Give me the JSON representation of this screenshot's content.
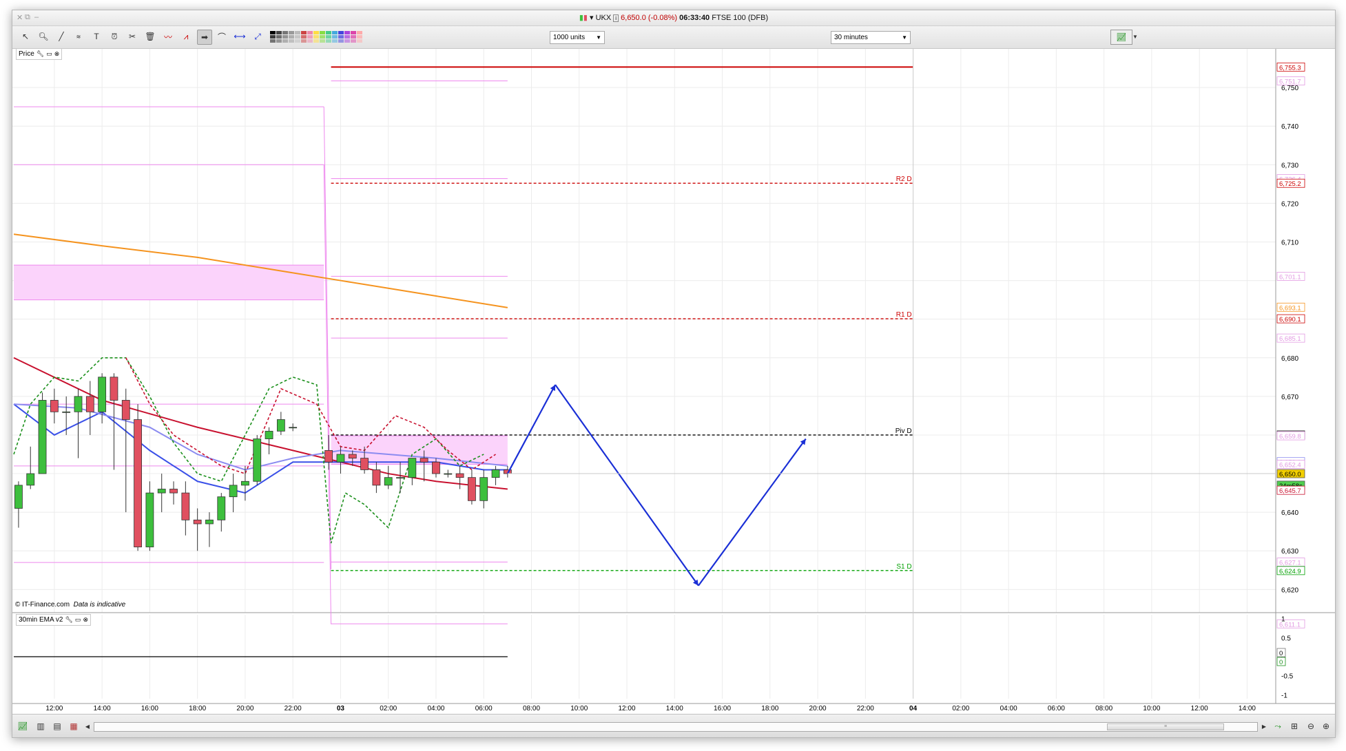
{
  "window": {
    "title": {
      "symbol": "UKX",
      "price_change": "6,650.0 (-0.08%)",
      "time": "06:33:40",
      "instrument": "FTSE 100 (DFB)"
    }
  },
  "toolbar": {
    "units_select": "1000 units",
    "interval_select": "30 minutes"
  },
  "panels": {
    "price_label": "Price",
    "indicator_label": "30min EMA v2",
    "watermark_source": "© IT-Finance.com",
    "watermark_note": "Data is indicative"
  },
  "colors": {
    "up_candle": "#3dbf3d",
    "down_candle": "#e05060",
    "pivot_red": "#cc0000",
    "pivot_green": "#00a000",
    "ema_orange": "#f5931e",
    "ema_red": "#c8102e",
    "ema_blue": "#1f3fe0",
    "envelope_pink": "#ee88ee",
    "forecast_arrow": "#1a2fd6"
  },
  "chart_data": {
    "type": "candlestick",
    "timeframe": "30 minutes",
    "ylim": [
      6614,
      6760
    ],
    "y_ticks": [
      "6,750",
      "6,740",
      "6,730",
      "6,720",
      "6,710",
      "6,680",
      "6,670",
      "6,660",
      "6,640",
      "6,630",
      "6,620"
    ],
    "x_ticks": [
      "12:00",
      "14:00",
      "16:00",
      "18:00",
      "20:00",
      "22:00",
      "03",
      "02:00",
      "04:00",
      "06:00",
      "08:00",
      "10:00",
      "12:00",
      "14:00",
      "16:00",
      "18:00",
      "20:00",
      "22:00",
      "04",
      "02:00",
      "04:00",
      "06:00",
      "08:00",
      "10:00",
      "12:00",
      "14:00"
    ],
    "x_tick_hours": [
      12,
      14,
      16,
      18,
      20,
      22,
      24,
      26,
      28,
      30,
      32,
      34,
      36,
      38,
      40,
      42,
      44,
      46,
      48,
      50,
      52,
      54,
      56,
      58,
      60,
      62
    ],
    "x_range_hours": [
      10.3,
      63.2
    ],
    "candles": [
      {
        "t": 10.5,
        "o": 6641,
        "h": 6648,
        "l": 6636,
        "c": 6647
      },
      {
        "t": 11.0,
        "o": 6647,
        "h": 6657,
        "l": 6646,
        "c": 6650
      },
      {
        "t": 11.5,
        "o": 6650,
        "h": 6671,
        "l": 6650,
        "c": 6669
      },
      {
        "t": 12.0,
        "o": 6669,
        "h": 6672,
        "l": 6663,
        "c": 6666
      },
      {
        "t": 12.5,
        "o": 6666,
        "h": 6670,
        "l": 6660,
        "c": 6666
      },
      {
        "t": 13.0,
        "o": 6666,
        "h": 6672,
        "l": 6654,
        "c": 6670
      },
      {
        "t": 13.5,
        "o": 6670,
        "h": 6674,
        "l": 6660,
        "c": 6666
      },
      {
        "t": 14.0,
        "o": 6666,
        "h": 6676,
        "l": 6663,
        "c": 6675
      },
      {
        "t": 14.5,
        "o": 6675,
        "h": 6676,
        "l": 6651,
        "c": 6669
      },
      {
        "t": 15.0,
        "o": 6669,
        "h": 6672,
        "l": 6640,
        "c": 6664
      },
      {
        "t": 15.5,
        "o": 6664,
        "h": 6668,
        "l": 6630,
        "c": 6631
      },
      {
        "t": 16.0,
        "o": 6631,
        "h": 6648,
        "l": 6630,
        "c": 6645
      },
      {
        "t": 16.5,
        "o": 6645,
        "h": 6650,
        "l": 6640,
        "c": 6646
      },
      {
        "t": 17.0,
        "o": 6646,
        "h": 6648,
        "l": 6642,
        "c": 6645
      },
      {
        "t": 17.5,
        "o": 6645,
        "h": 6648,
        "l": 6634,
        "c": 6638
      },
      {
        "t": 18.0,
        "o": 6638,
        "h": 6641,
        "l": 6630,
        "c": 6637
      },
      {
        "t": 18.5,
        "o": 6637,
        "h": 6640,
        "l": 6631,
        "c": 6638
      },
      {
        "t": 19.0,
        "o": 6638,
        "h": 6645,
        "l": 6635,
        "c": 6644
      },
      {
        "t": 19.5,
        "o": 6644,
        "h": 6650,
        "l": 6640,
        "c": 6647
      },
      {
        "t": 20.0,
        "o": 6647,
        "h": 6652,
        "l": 6643,
        "c": 6648
      },
      {
        "t": 20.5,
        "o": 6648,
        "h": 6660,
        "l": 6647,
        "c": 6659
      },
      {
        "t": 21.0,
        "o": 6659,
        "h": 6662,
        "l": 6655,
        "c": 6661
      },
      {
        "t": 21.5,
        "o": 6661,
        "h": 6666,
        "l": 6660,
        "c": 6664
      },
      {
        "t": 22.0,
        "o": 6662,
        "h": 6663,
        "l": 6661,
        "c": 6662
      },
      {
        "t": 23.5,
        "o": 6656,
        "h": 6660,
        "l": 6651,
        "c": 6653
      },
      {
        "t": 24.0,
        "o": 6653,
        "h": 6657,
        "l": 6650,
        "c": 6655
      },
      {
        "t": 24.5,
        "o": 6655,
        "h": 6656,
        "l": 6652,
        "c": 6654
      },
      {
        "t": 25.0,
        "o": 6654,
        "h": 6657,
        "l": 6650,
        "c": 6651
      },
      {
        "t": 25.5,
        "o": 6651,
        "h": 6653,
        "l": 6645,
        "c": 6647
      },
      {
        "t": 26.0,
        "o": 6647,
        "h": 6652,
        "l": 6646,
        "c": 6649
      },
      {
        "t": 26.5,
        "o": 6649,
        "h": 6653,
        "l": 6645,
        "c": 6649
      },
      {
        "t": 27.0,
        "o": 6649,
        "h": 6654,
        "l": 6647,
        "c": 6654
      },
      {
        "t": 27.5,
        "o": 6654,
        "h": 6656,
        "l": 6648,
        "c": 6653
      },
      {
        "t": 28.0,
        "o": 6653,
        "h": 6654,
        "l": 6649,
        "c": 6650
      },
      {
        "t": 28.5,
        "o": 6650,
        "h": 6651,
        "l": 6649,
        "c": 6650
      },
      {
        "t": 29.0,
        "o": 6650,
        "h": 6652,
        "l": 6646,
        "c": 6649
      },
      {
        "t": 29.5,
        "o": 6649,
        "h": 6651,
        "l": 6642,
        "c": 6643
      },
      {
        "t": 30.0,
        "o": 6643,
        "h": 6651,
        "l": 6641,
        "c": 6649
      },
      {
        "t": 30.5,
        "o": 6649,
        "h": 6652,
        "l": 6647,
        "c": 6651
      },
      {
        "t": 31.0,
        "o": 6651,
        "h": 6652,
        "l": 6649,
        "c": 6650
      }
    ],
    "series": [
      {
        "name": "ema_long",
        "color": "#f5931e",
        "style": "solid",
        "points": [
          [
            10.3,
            6712
          ],
          [
            14,
            6709
          ],
          [
            18,
            6706
          ],
          [
            22,
            6702
          ],
          [
            24,
            6700
          ],
          [
            26,
            6698
          ],
          [
            28,
            6696
          ],
          [
            31,
            6693
          ]
        ]
      },
      {
        "name": "ema_mid",
        "color": "#c8102e",
        "style": "solid",
        "points": [
          [
            10.3,
            6680
          ],
          [
            14,
            6669
          ],
          [
            18,
            6662
          ],
          [
            22,
            6656
          ],
          [
            24,
            6653
          ],
          [
            26,
            6650
          ],
          [
            28,
            6648
          ],
          [
            31,
            6646
          ]
        ]
      },
      {
        "name": "ema_short",
        "color": "#3a50e8",
        "style": "solid",
        "points": [
          [
            10.3,
            6668
          ],
          [
            12,
            6660
          ],
          [
            14,
            6666
          ],
          [
            16,
            6656
          ],
          [
            18,
            6648
          ],
          [
            20,
            6645
          ],
          [
            22,
            6653
          ],
          [
            24,
            6653
          ],
          [
            26,
            6653
          ],
          [
            28,
            6653
          ],
          [
            30,
            6651
          ],
          [
            31,
            6651
          ]
        ]
      },
      {
        "name": "ema_fast_light",
        "color": "#8b8bf0",
        "style": "solid",
        "points": [
          [
            10.3,
            6668
          ],
          [
            13,
            6667
          ],
          [
            16,
            6662
          ],
          [
            18,
            6655
          ],
          [
            20,
            6651
          ],
          [
            22,
            6654
          ],
          [
            24,
            6656
          ],
          [
            26,
            6655
          ],
          [
            28,
            6654
          ],
          [
            31,
            6652
          ]
        ]
      }
    ],
    "pivots": [
      {
        "label": "R2 D",
        "value": 6725.2,
        "color": "#cc0000"
      },
      {
        "label": "R1 D",
        "value": 6690.1,
        "color": "#cc0000"
      },
      {
        "label": "Piv D",
        "value": 6660.0,
        "color": "#000000"
      },
      {
        "label": "S1 D",
        "value": 6624.9,
        "color": "#00a000"
      }
    ],
    "price_labels": [
      {
        "text": "6,755.3",
        "value": 6755.3,
        "color": "#cc0000",
        "bg": "#ffffff",
        "solid": false
      },
      {
        "text": "6,751.7",
        "value": 6751.7,
        "color": "#e29ae2",
        "bg": "#ffffff",
        "solid": false
      },
      {
        "text": "6,726.4",
        "value": 6726.4,
        "color": "#e29ae2",
        "bg": "#ffffff",
        "solid": false
      },
      {
        "text": "6,725.2",
        "value": 6725.2,
        "color": "#cc0000",
        "bg": "#ffffff",
        "solid": false
      },
      {
        "text": "6,701.1",
        "value": 6701.1,
        "color": "#e29ae2",
        "bg": "#ffffff",
        "solid": false
      },
      {
        "text": "6,693.1",
        "value": 6693.1,
        "color": "#f5931e",
        "bg": "#ffffff",
        "solid": false
      },
      {
        "text": "6,690.1",
        "value": 6690.1,
        "color": "#cc0000",
        "bg": "#ffffff",
        "solid": false
      },
      {
        "text": "6,685.1",
        "value": 6685.1,
        "color": "#e29ae2",
        "bg": "#ffffff",
        "solid": false
      },
      {
        "text": "6,660.0",
        "value": 6660.0,
        "color": "#000000",
        "bg": "#ffffff",
        "solid": false
      },
      {
        "text": "6,659.8",
        "value": 6659.8,
        "color": "#e29ae2",
        "bg": "#ffffff",
        "solid": false
      },
      {
        "text": "6,653.1",
        "value": 6653.1,
        "color": "#8b8bf0",
        "bg": "#ffffff",
        "solid": false
      },
      {
        "text": "6,652.4",
        "value": 6652.4,
        "color": "#e29ae2",
        "bg": "#ffffff",
        "solid": false
      },
      {
        "text": "6,650.0",
        "value": 6650.0,
        "color": "#000000",
        "bg": "#f2cf00",
        "solid": true
      },
      {
        "text": "24m58s",
        "value": 6647.0,
        "color": "#000000",
        "bg": "#4fcf4f",
        "solid": true
      },
      {
        "text": "6,645.7",
        "value": 6645.7,
        "color": "#c8102e",
        "bg": "#ffffff",
        "solid": false
      },
      {
        "text": "6,627.1",
        "value": 6627.1,
        "color": "#e29ae2",
        "bg": "#ffffff",
        "solid": false
      },
      {
        "text": "6,624.9",
        "value": 6624.9,
        "color": "#00a000",
        "bg": "#ffffff",
        "solid": false
      },
      {
        "text": "6,611.1",
        "value": 6611.1,
        "color": "#e29ae2",
        "bg": "#ffffff",
        "solid": false
      }
    ],
    "forecast_path": [
      [
        31,
        6650
      ],
      [
        33.0,
        6673
      ],
      [
        39.0,
        6621
      ],
      [
        43.5,
        6659
      ]
    ],
    "indicator": {
      "ylim": [
        -1.1,
        1.1
      ],
      "y_ticks": [
        "1",
        "0.5",
        "0",
        "-0.5",
        "-1"
      ],
      "y_tick_values": [
        1,
        0.5,
        0,
        -0.5,
        -1
      ],
      "value_labels": [
        "0",
        "0"
      ],
      "line_value": 0
    }
  }
}
